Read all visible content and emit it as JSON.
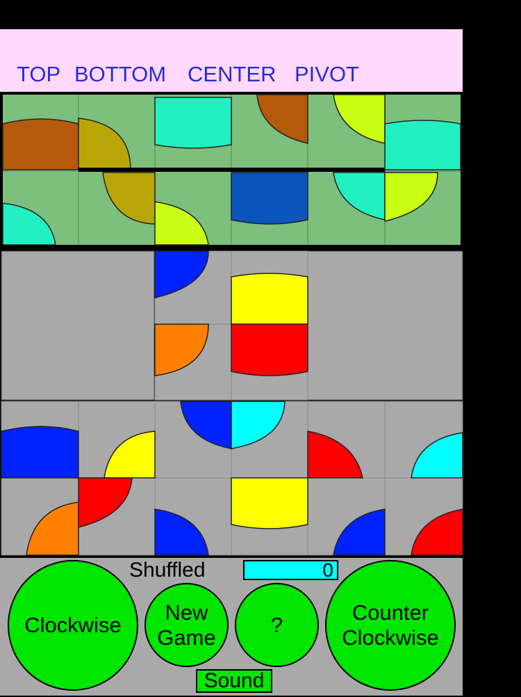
{
  "header": {
    "buttons": [
      {
        "label": "TOP"
      },
      {
        "label": "BOTTOM"
      },
      {
        "label": "CENTER"
      },
      {
        "label": "PIVOT"
      }
    ]
  },
  "colors": {
    "header_bg": "#ffd8fc",
    "header_text": "#2a2adb",
    "target_bg": "#7dbf7d",
    "play_bg": "#a9a9a9",
    "button_green": "#00e600",
    "counter_bg": "#00ffff"
  },
  "status": {
    "label": "Shuffled",
    "move_count": "0"
  },
  "controls": {
    "clockwise": "Clockwise",
    "new_game_line1": "New",
    "new_game_line2": "Game",
    "help": "?",
    "counter_clockwise_line1": "Counter",
    "counter_clockwise_line2": "Clockwise",
    "sound": "Sound"
  }
}
